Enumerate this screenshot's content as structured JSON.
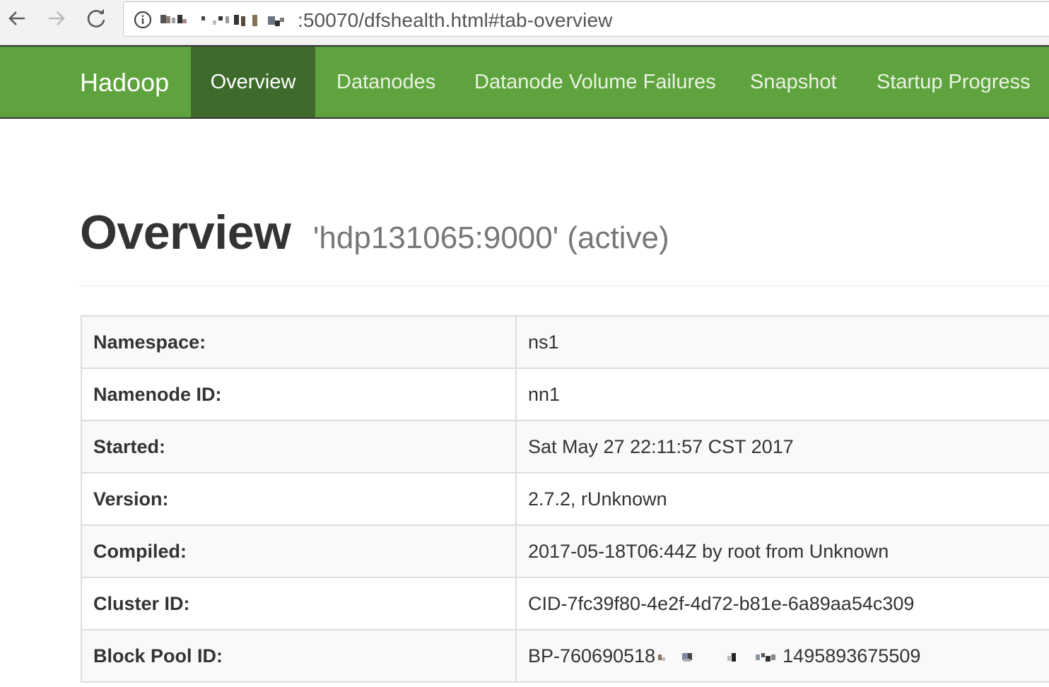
{
  "browser": {
    "url_suffix": ":50070/dfshealth.html#tab-overview",
    "icons": [
      "back-arrow-icon",
      "forward-arrow-icon",
      "reload-icon",
      "info-icon"
    ]
  },
  "navbar": {
    "brand": "Hadoop",
    "items": [
      {
        "label": "Overview",
        "active": true
      },
      {
        "label": "Datanodes",
        "active": false
      },
      {
        "label": "Datanode Volume Failures",
        "active": false
      },
      {
        "label": "Snapshot",
        "active": false
      },
      {
        "label": "Startup Progress",
        "active": false
      }
    ],
    "color": "#5fa33e",
    "active_color": "#3e6a2b"
  },
  "page": {
    "title": "Overview",
    "subtitle": "'hdp131065:9000' (active)"
  },
  "overview_table": {
    "rows": [
      {
        "key": "Namespace:",
        "value": "ns1"
      },
      {
        "key": "Namenode ID:",
        "value": "nn1"
      },
      {
        "key": "Started:",
        "value": "Sat May 27 22:11:57 CST 2017"
      },
      {
        "key": "Version:",
        "value": "2.7.2, rUnknown"
      },
      {
        "key": "Compiled:",
        "value": "2017-05-18T06:44Z by root from Unknown"
      },
      {
        "key": "Cluster ID:",
        "value": "CID-7fc39f80-4e2f-4d72-b81e-6a89aa54c309"
      },
      {
        "key": "Block Pool ID:",
        "value_prefix": "BP-760690518",
        "value_suffix": "1495893675509"
      }
    ]
  }
}
